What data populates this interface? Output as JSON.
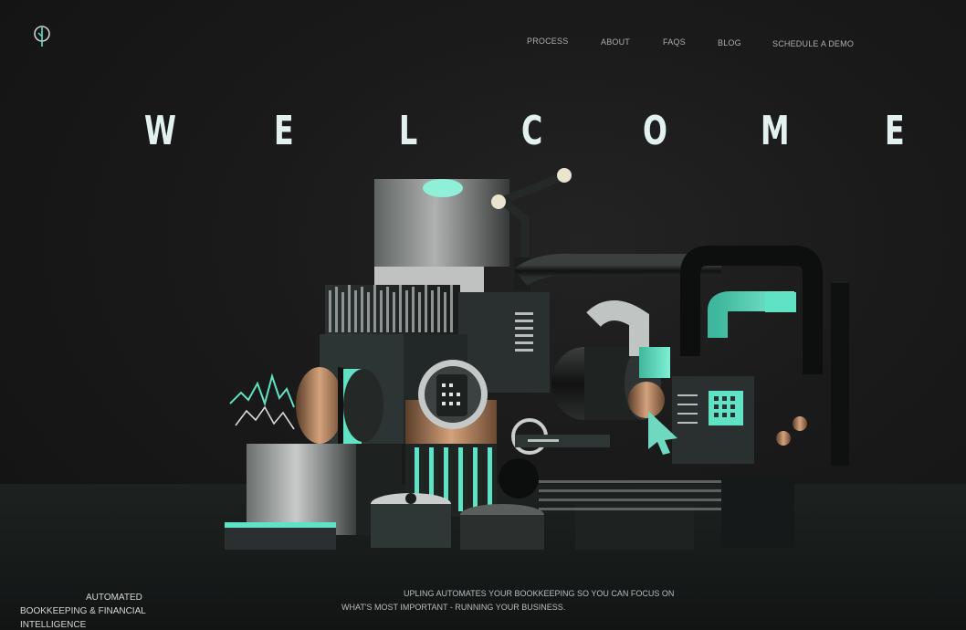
{
  "brand": {
    "logo_icon": "leaf-drop-icon",
    "accent": "#5fe3c4"
  },
  "nav": {
    "items": [
      {
        "label": "PROCESS"
      },
      {
        "label": "ABOUT"
      },
      {
        "label": "FAQS"
      },
      {
        "label": "BLOG"
      },
      {
        "label": "SCHEDULE A DEMO"
      }
    ]
  },
  "hero": {
    "letters": [
      "W",
      "E",
      "L",
      "C",
      "O",
      "M",
      "E"
    ]
  },
  "footer": {
    "left_lines": [
      "AUTOMATED",
      "BOOKKEEPING & FINANCIAL",
      "INTELLIGENCE"
    ],
    "center_lines": [
      "UPLING AUTOMATES YOUR BOOKKEEPING SO YOU CAN FOCUS ON",
      "WHAT'S MOST IMPORTANT - RUNNING YOUR BUSINESS."
    ]
  }
}
